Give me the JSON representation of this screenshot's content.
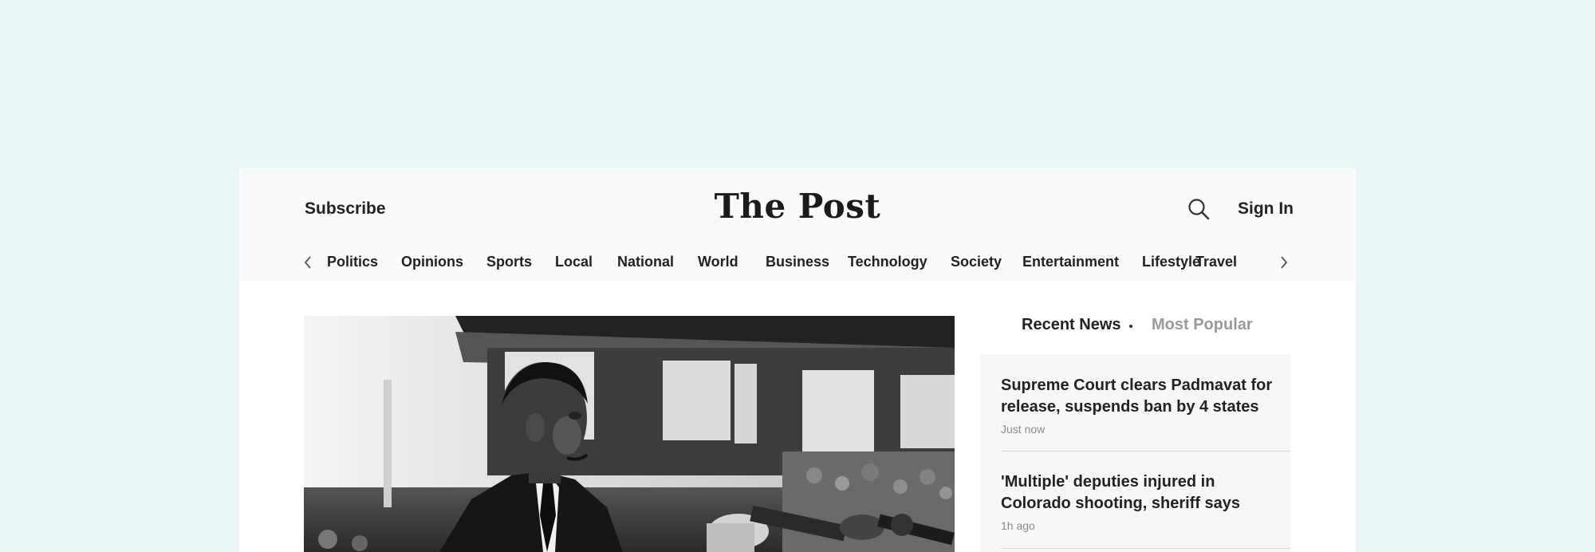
{
  "header": {
    "subscribe_label": "Subscribe",
    "logo": "The Post",
    "signin_label": "Sign In",
    "search_icon": "search-icon"
  },
  "nav": {
    "prev_icon": "chevron-left-icon",
    "next_icon": "chevron-right-icon",
    "items": [
      {
        "label": "Politics"
      },
      {
        "label": "Opinions"
      },
      {
        "label": "Sports"
      },
      {
        "label": "Local"
      },
      {
        "label": "National"
      },
      {
        "label": "World"
      },
      {
        "label": "Business"
      },
      {
        "label": "Technology"
      },
      {
        "label": "Society"
      },
      {
        "label": "Entertainment"
      },
      {
        "label": "Lifestyle"
      },
      {
        "label": "Travel"
      }
    ]
  },
  "sidebar": {
    "tabs": {
      "recent": "Recent News",
      "popular": "Most Popular"
    },
    "news": [
      {
        "title": "Supreme Court clears Padmavat for release, suspends ban by 4 states",
        "time": "Just now"
      },
      {
        "title": "'Multiple' deputies injured in Colorado shooting, sheriff says",
        "time": "1h ago"
      }
    ]
  },
  "colors": {
    "page_background": "#e8f6f7",
    "masthead_background": "#fafafa",
    "text_primary": "#222222",
    "text_muted": "#9a9a9a"
  }
}
